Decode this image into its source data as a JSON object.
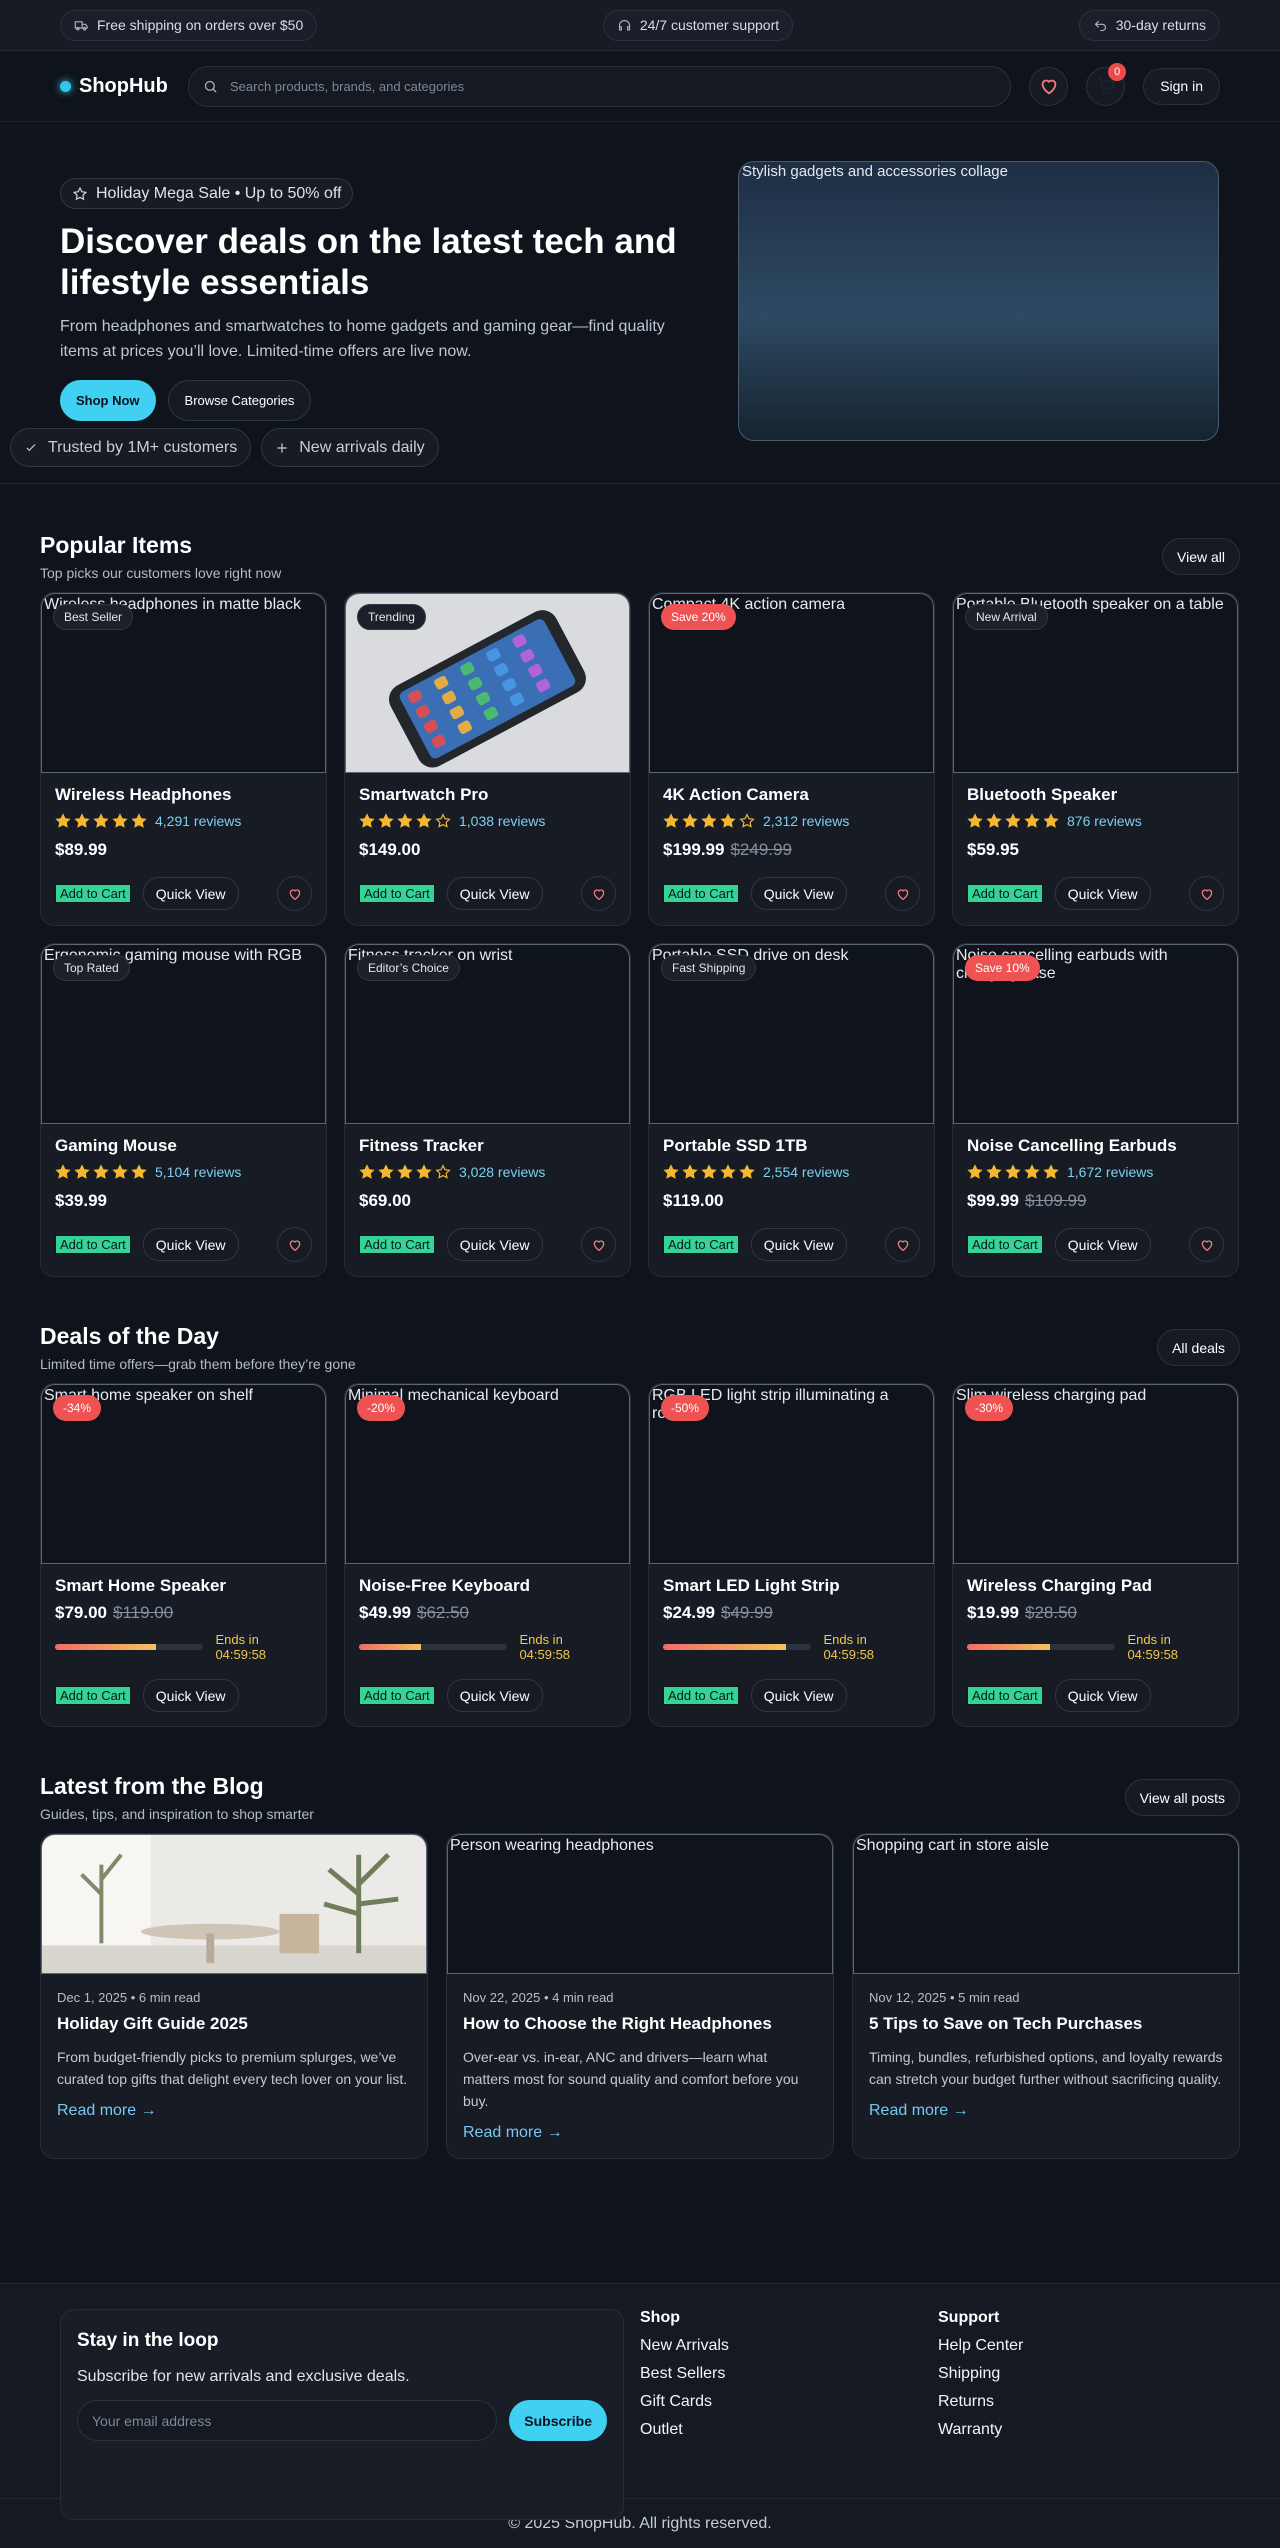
{
  "topbar": {
    "shipping": "Free shipping on orders over $50",
    "support": "24/7 customer support",
    "returns": "30-day returns"
  },
  "header": {
    "brand": "ShopHub",
    "search_placeholder": "Search products, brands, and categories",
    "cart_count": "0",
    "signin": "Sign in"
  },
  "hero": {
    "chip": "Holiday Mega Sale • Up to 50% off",
    "title": "Discover deals on the latest tech and lifestyle essentials",
    "text": "From headphones and smartwatches to home gadgets and gaming gear—find quality items at prices you’ll love. Limited-time offers are live now.",
    "shop_now": "Shop Now",
    "browse": "Browse Categories",
    "trust1": "Trusted by 1M+ customers",
    "trust2": "New arrivals daily",
    "image_alt": "Stylish gadgets and accessories collage"
  },
  "popular": {
    "title": "Popular Items",
    "subtitle": "Top picks our customers love right now",
    "view_all": "View all",
    "add_label": "Add to Cart",
    "quick_label": "Quick View",
    "items": [
      {
        "name": "Wireless Headphones",
        "tag": "Best Seller",
        "tag_style": "dark",
        "alt": "Wireless headphones in matte black",
        "rating": 5,
        "reviews": "4,291 reviews",
        "price": "$89.99",
        "old": ""
      },
      {
        "name": "Smartwatch Pro",
        "tag": "Trending",
        "tag_style": "dark",
        "alt": "",
        "rating": 4,
        "reviews": "1,038 reviews",
        "price": "$149.00",
        "old": "",
        "photo": "phone"
      },
      {
        "name": "4K Action Camera",
        "tag": "Save 20%",
        "tag_style": "red",
        "alt": "Compact 4K action camera",
        "rating": 4,
        "reviews": "2,312 reviews",
        "price": "$199.99",
        "old": "$249.99"
      },
      {
        "name": "Bluetooth Speaker",
        "tag": "New Arrival",
        "tag_style": "dark",
        "alt": "Portable Bluetooth speaker on a table",
        "rating": 5,
        "reviews": "876 reviews",
        "price": "$59.95",
        "old": ""
      },
      {
        "name": "Gaming Mouse",
        "tag": "Top Rated",
        "tag_style": "dark",
        "alt": "Ergonomic gaming mouse with RGB",
        "rating": 5,
        "reviews": "5,104 reviews",
        "price": "$39.99",
        "old": ""
      },
      {
        "name": "Fitness Tracker",
        "tag": "Editor’s Choice",
        "tag_style": "dark",
        "alt": "Fitness tracker on wrist",
        "rating": 4,
        "reviews": "3,028 reviews",
        "price": "$69.00",
        "old": ""
      },
      {
        "name": "Portable SSD 1TB",
        "tag": "Fast Shipping",
        "tag_style": "dark",
        "alt": "Portable SSD drive on desk",
        "rating": 5,
        "reviews": "2,554 reviews",
        "price": "$119.00",
        "old": ""
      },
      {
        "name": "Noise Cancelling Earbuds",
        "tag": "Save 10%",
        "tag_style": "red",
        "alt": "Noise cancelling earbuds with charging case",
        "rating": 5,
        "reviews": "1,672 reviews",
        "price": "$99.99",
        "old": "$109.99"
      }
    ]
  },
  "deals": {
    "title": "Deals of the Day",
    "subtitle": "Limited time offers—grab them before they’re gone",
    "all_deals": "All deals",
    "items": [
      {
        "name": "Smart Home Speaker",
        "tag": "-34%",
        "alt": "Smart home speaker on shelf",
        "price": "$79.00",
        "old": "$119.00",
        "progress": 0.68,
        "ends": "Ends in 04:59:58"
      },
      {
        "name": "Noise-Free Keyboard",
        "tag": "-20%",
        "alt": "Minimal mechanical keyboard",
        "price": "$49.99",
        "old": "$62.50",
        "progress": 0.42,
        "ends": "Ends in 04:59:58"
      },
      {
        "name": "Smart LED Light Strip",
        "tag": "-50%",
        "alt": "RGB LED light strip illuminating a room",
        "price": "$24.99",
        "old": "$49.99",
        "progress": 0.83,
        "ends": "Ends in 04:59:58"
      },
      {
        "name": "Wireless Charging Pad",
        "tag": "-30%",
        "alt": "Slim wireless charging pad",
        "price": "$19.99",
        "old": "$28.50",
        "progress": 0.56,
        "ends": "Ends in 04:59:58"
      }
    ]
  },
  "blog": {
    "title": "Latest from the Blog",
    "subtitle": "Guides, tips, and inspiration to shop smarter",
    "view_all": "View all posts",
    "read_more": "Read more →",
    "posts": [
      {
        "meta": "Dec 1, 2025 • 6 min read",
        "title": "Holiday Gift Guide 2025",
        "desc": "From budget-friendly picks to premium splurges, we’ve curated top gifts that delight every tech lover on your list.",
        "alt": "",
        "photo": "room"
      },
      {
        "meta": "Nov 22, 2025 • 4 min read",
        "title": "How to Choose the Right Headphones",
        "desc": "Over-ear vs. in-ear, ANC and drivers—learn what matters most for sound quality and comfort before you buy.",
        "alt": "Person wearing headphones"
      },
      {
        "meta": "Nov 12, 2025 • 5 min read",
        "title": "5 Tips to Save on Tech Purchases",
        "desc": "Timing, bundles, refurbished options, and loyalty rewards can stretch your budget further without sacrificing quality.",
        "alt": "Shopping cart in store aisle"
      }
    ]
  },
  "footer": {
    "news_title": "Stay in the loop",
    "news_text": "Subscribe for new arrivals and exclusive deals.",
    "email_placeholder": "Your email address",
    "subscribe": "Subscribe",
    "shop": {
      "title": "Shop",
      "links": [
        "New Arrivals",
        "Best Sellers",
        "Gift Cards",
        "Outlet"
      ]
    },
    "support": {
      "title": "Support",
      "links": [
        "Help Center",
        "Shipping",
        "Returns",
        "Warranty"
      ]
    },
    "copyright": "© 2025 ShopHub. All rights reserved."
  },
  "colors": {
    "accent": "#3fd0f2",
    "star": "#f5b632",
    "sale": "#ee5252",
    "add": "#36d399",
    "link": "#79c8f2"
  }
}
